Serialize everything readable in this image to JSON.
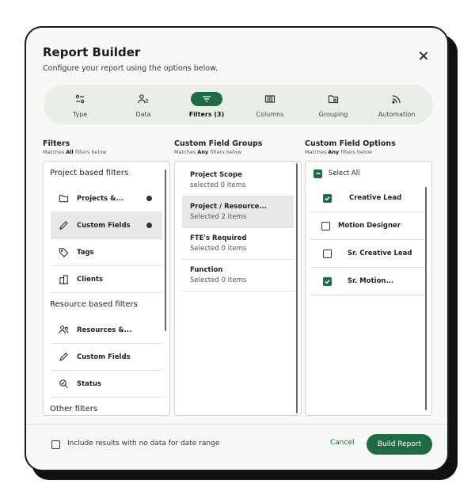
{
  "dialog": {
    "title": "Report Builder",
    "subtitle": "Configure your report using the options below."
  },
  "steps": [
    {
      "label": "Type",
      "icon": "sliders-icon"
    },
    {
      "label": "Data",
      "icon": "users-data-icon"
    },
    {
      "label": "Filters (3)",
      "icon": "filter-icon",
      "active": true
    },
    {
      "label": "Columns",
      "icon": "columns-icon"
    },
    {
      "label": "Grouping",
      "icon": "folder-settings-icon"
    },
    {
      "label": "Automation",
      "icon": "broadcast-icon"
    }
  ],
  "filters_col": {
    "title": "Filters",
    "sub_prefix": "Matches ",
    "sub_bold": "All",
    "sub_suffix": " filters below"
  },
  "groups_col": {
    "title": "Custom Field Groups",
    "sub_prefix": "Matches ",
    "sub_bold": "Any",
    "sub_suffix": " filters below"
  },
  "options_col": {
    "title": "Custom Field Options",
    "sub_prefix": "Matches ",
    "sub_bold": "Any",
    "sub_suffix": " filters below"
  },
  "project_filters": {
    "label": "Project based filters",
    "items": [
      {
        "label": "Projects &...",
        "icon": "folder-icon",
        "has_dot": true
      },
      {
        "label": "Custom Fields",
        "icon": "pencil-icon",
        "has_dot": true,
        "selected": true
      },
      {
        "label": "Tags",
        "icon": "tag-icon"
      },
      {
        "label": "Clients",
        "icon": "building-icon"
      }
    ]
  },
  "resource_filters": {
    "label": "Resource based filters",
    "items": [
      {
        "label": "Resources &...",
        "icon": "users-icon"
      },
      {
        "label": "Custom Fields",
        "icon": "pencil-icon"
      },
      {
        "label": "Status",
        "icon": "status-search-icon"
      }
    ]
  },
  "other_filters": {
    "label": "Other filters"
  },
  "field_groups": [
    {
      "name": "Project Scope",
      "count": "selected 0 items"
    },
    {
      "name": "Project / Resource...",
      "count": "Selected 2 items",
      "selected": true
    },
    {
      "name": "FTE's Required",
      "count": "Selected 0 items"
    },
    {
      "name": "Function",
      "count": "Selected 0 items"
    }
  ],
  "options": {
    "select_all": "Select All",
    "items": [
      {
        "label": "Creative Lead",
        "checked": true
      },
      {
        "label": "Motion Designer",
        "checked": false
      },
      {
        "label": "Sr. Creative Lead",
        "checked": false
      },
      {
        "label": "Sr. Motion...",
        "checked": true
      }
    ]
  },
  "footer": {
    "include_label": "Include results with no data for date range",
    "cancel": "Cancel",
    "build": "Build Report"
  },
  "colors": {
    "accent": "#1e6b45",
    "stepper_bg": "#e8efe7"
  }
}
